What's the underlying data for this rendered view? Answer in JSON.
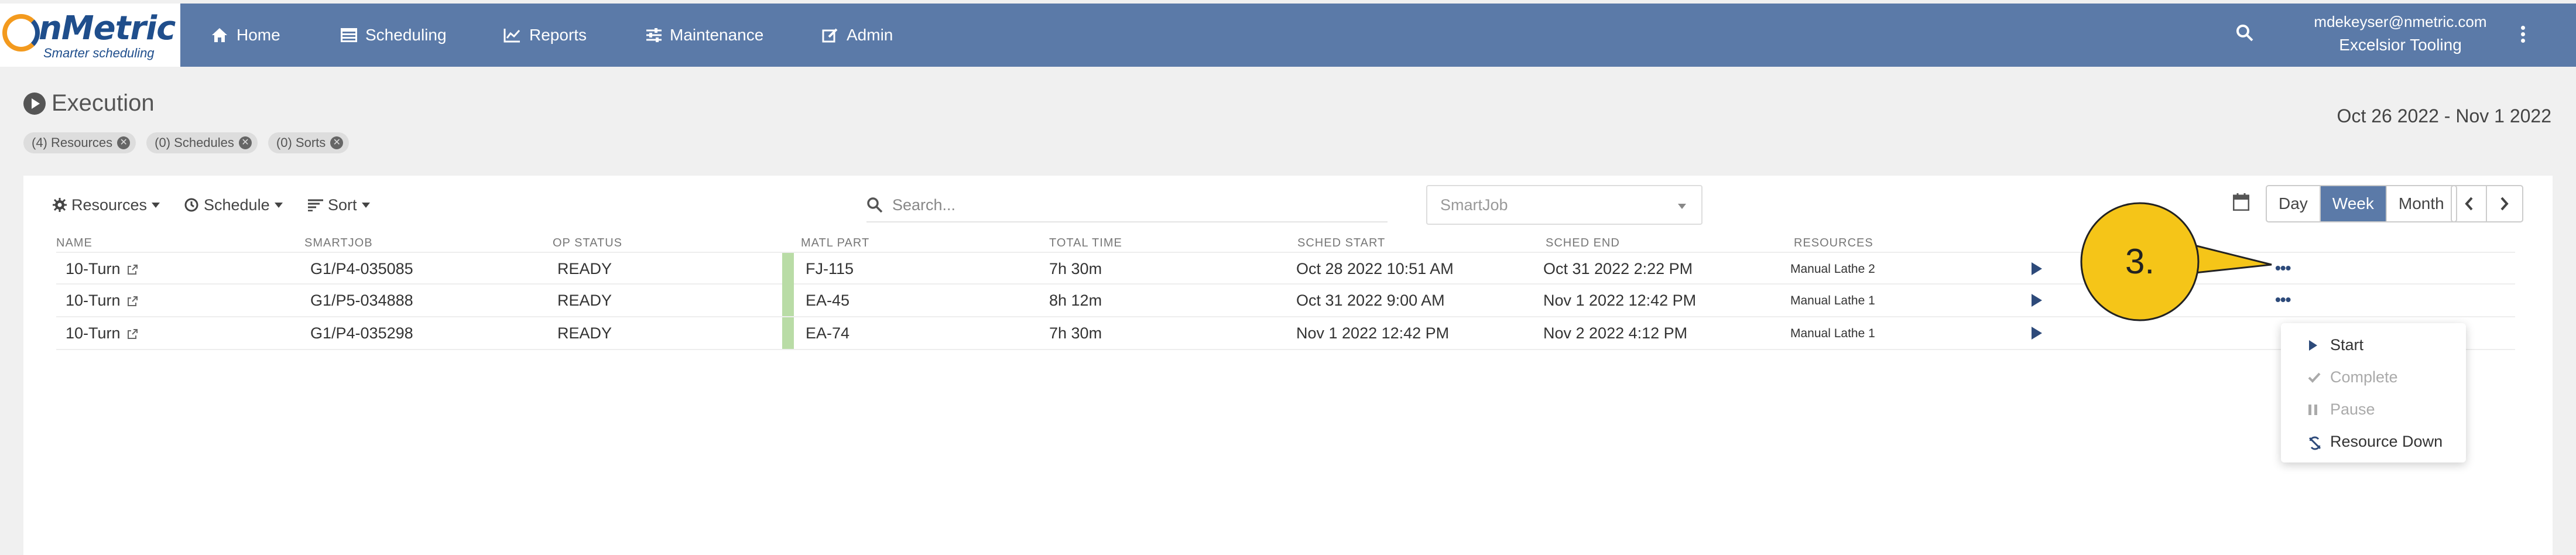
{
  "brand": {
    "name": "nMetric",
    "tagline": "Smarter scheduling"
  },
  "nav": [
    {
      "label": "Home",
      "icon": "home-icon"
    },
    {
      "label": "Scheduling",
      "icon": "scheduling-icon"
    },
    {
      "label": "Reports",
      "icon": "chart-icon"
    },
    {
      "label": "Maintenance",
      "icon": "sliders-icon"
    },
    {
      "label": "Admin",
      "icon": "edit-icon"
    }
  ],
  "user": {
    "email": "mdekeyser@nmetric.com",
    "company": "Excelsior Tooling"
  },
  "page": {
    "title": "Execution",
    "date_range": "Oct 26 2022 - Nov 1 2022"
  },
  "chips": [
    {
      "label": "(4) Resources"
    },
    {
      "label": "(0) Schedules"
    },
    {
      "label": "(0) Sorts"
    }
  ],
  "toolbar": {
    "resources": "Resources",
    "schedule": "Schedule",
    "sort": "Sort",
    "search_placeholder": "Search...",
    "select_value": "SmartJob",
    "ranges": [
      "Day",
      "Week",
      "Month"
    ],
    "active_range": "Week"
  },
  "columns": [
    "NAME",
    "SMARTJOB",
    "OP STATUS",
    "MATL PART",
    "TOTAL TIME",
    "SCHED START",
    "SCHED END",
    "RESOURCES"
  ],
  "rows": [
    {
      "name": "10-Turn",
      "smartjob": "G1/P4-035085",
      "status": "READY",
      "part": "FJ-115",
      "total": "7h 30m",
      "start": "Oct 28 2022 10:51 AM",
      "end": "Oct 31 2022 2:22 PM",
      "resource": "Manual Lathe 2"
    },
    {
      "name": "10-Turn",
      "smartjob": "G1/P5-034888",
      "status": "READY",
      "part": "EA-45",
      "total": "8h 12m",
      "start": "Oct 31 2022 9:00 AM",
      "end": "Nov 1 2022 12:42 PM",
      "resource": "Manual Lathe 1"
    },
    {
      "name": "10-Turn",
      "smartjob": "G1/P4-035298",
      "status": "READY",
      "part": "EA-74",
      "total": "7h 30m",
      "start": "Nov 1 2022 12:42 PM",
      "end": "Nov 2 2022 4:12 PM",
      "resource": "Manual Lathe 1"
    }
  ],
  "row_menu": [
    {
      "label": "Start",
      "enabled": true,
      "icon": "play-icon"
    },
    {
      "label": "Complete",
      "enabled": false,
      "icon": "check-icon"
    },
    {
      "label": "Pause",
      "enabled": false,
      "icon": "pause-icon"
    },
    {
      "label": "Resource Down",
      "enabled": true,
      "icon": "resource-down-icon"
    }
  ],
  "callout": {
    "label": "3."
  },
  "colors": {
    "navbar": "#5b7aa8",
    "accent": "#2d4a7a",
    "status_ready": "#b9dca6",
    "callout": "#f5c518"
  }
}
